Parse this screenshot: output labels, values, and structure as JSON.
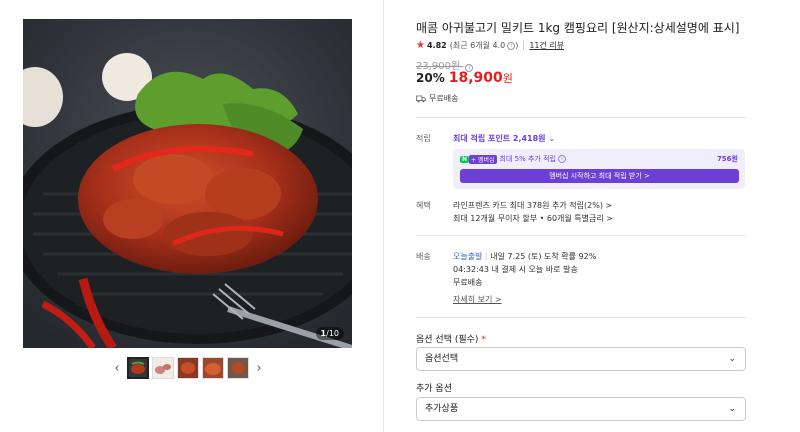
{
  "gallery": {
    "counter_current": "1",
    "counter_total": "/10",
    "prev_arrow": "‹",
    "next_arrow": "›"
  },
  "product": {
    "title": "매콤 아귀불고기 밀키트 1kg 캠핑요리 [원산지:상세설명에 표시]",
    "rating": "4.82",
    "rating_note": "(최근 6개월 4.0",
    "rating_note_end": ")",
    "review_link": "11건 리뷰",
    "original_price": "23,900원",
    "discount": "20%",
    "price": "18,900",
    "price_unit": "원",
    "shipping_free": "무료배송"
  },
  "points": {
    "label": "적립",
    "max_text": "최대 적립 포인트 2,418원",
    "member_badge_n": "N",
    "member_badge_plus": "+ 멤버십",
    "member_text": "최대 5% 추가 적립",
    "member_amount": "756원",
    "member_button": "멤버십 시작하고 최대 적립 받기 >"
  },
  "benefits": {
    "label": "혜택",
    "line1": "라인프렌즈 카드 최대 378원 추가 적립(2%) >",
    "line2": "최대 12개월 무이자 할부 • 60개월 특별금리 >"
  },
  "delivery": {
    "label": "배송",
    "today": "오늘출발",
    "eta": "내일 7.25 (토) 도착 확률 92%",
    "time": "04:32:43",
    "time_note": "내 결제 시 오늘 바로 발송",
    "free": "무료배송",
    "details_link": "자세히 보기 >"
  },
  "options": {
    "required_label": "옵션 선택 (필수)",
    "required_mark": "*",
    "required_value": "옵션선택",
    "extra_label": "추가 옵션",
    "extra_value": "추가상품"
  },
  "colors": {
    "accent_purple": "#6c3fd6",
    "price_red": "#e0201c",
    "today_blue": "#3366cc"
  }
}
